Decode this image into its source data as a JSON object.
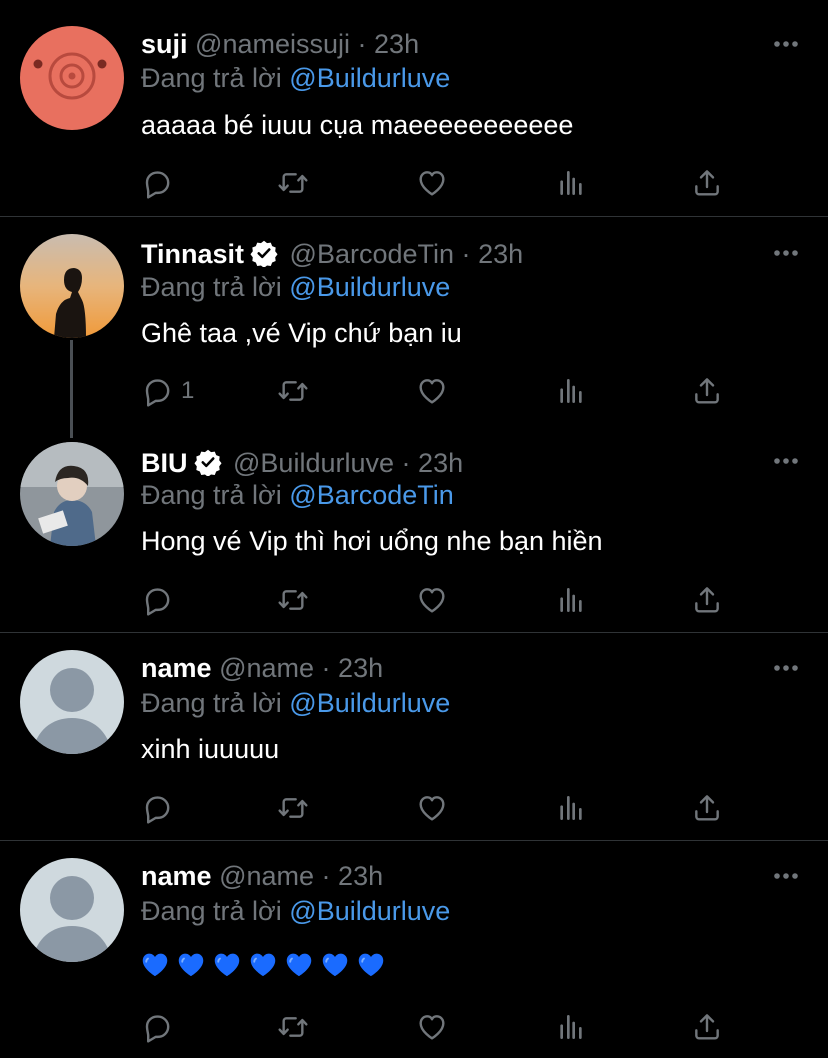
{
  "colors": {
    "background": "#000000",
    "text": "#ffffff",
    "muted": "#71767b",
    "accent": "#4a99e9",
    "divider": "#2f3336",
    "heart_emoji": "#1a6bff"
  },
  "reply_prefix": "Đang trả lời",
  "tweets": [
    {
      "name": "suji",
      "handle": "@nameissuji",
      "dot": "·",
      "time": "23h",
      "verified": false,
      "reply_to": "@Buildurluve",
      "text": "aaaaa bé iuuu cụa maeeeeeeeeeee",
      "reply_count": ""
    },
    {
      "name": "Tinnasit",
      "handle": "@BarcodeTin",
      "dot": "·",
      "time": "23h",
      "verified": true,
      "reply_to": "@Buildurluve",
      "text": "Ghê taa ,vé Vip chứ bạn iu",
      "reply_count": "1"
    },
    {
      "name": "BIU",
      "handle": "@Buildurluve",
      "dot": "·",
      "time": "23h",
      "verified": true,
      "reply_to": "@BarcodeTin",
      "text": "Hong vé Vip thì hơi uổng nhe bạn hiền",
      "reply_count": ""
    },
    {
      "name": "name",
      "handle": "@name",
      "dot": "·",
      "time": "23h",
      "verified": false,
      "reply_to": "@Buildurluve",
      "text": "xinh iuuuuu",
      "reply_count": ""
    },
    {
      "name": "name",
      "handle": "@name",
      "dot": "·",
      "time": "23h",
      "verified": false,
      "reply_to": "@Buildurluve",
      "text": "💙💙💙💙💙💙💙",
      "heart_count": 7,
      "reply_count": ""
    }
  ],
  "icons": {
    "reply": "reply-icon",
    "retweet": "retweet-icon",
    "like": "like-icon",
    "views": "views-icon",
    "share": "share-icon",
    "more": "more-icon",
    "verified": "verified-badge-icon"
  }
}
